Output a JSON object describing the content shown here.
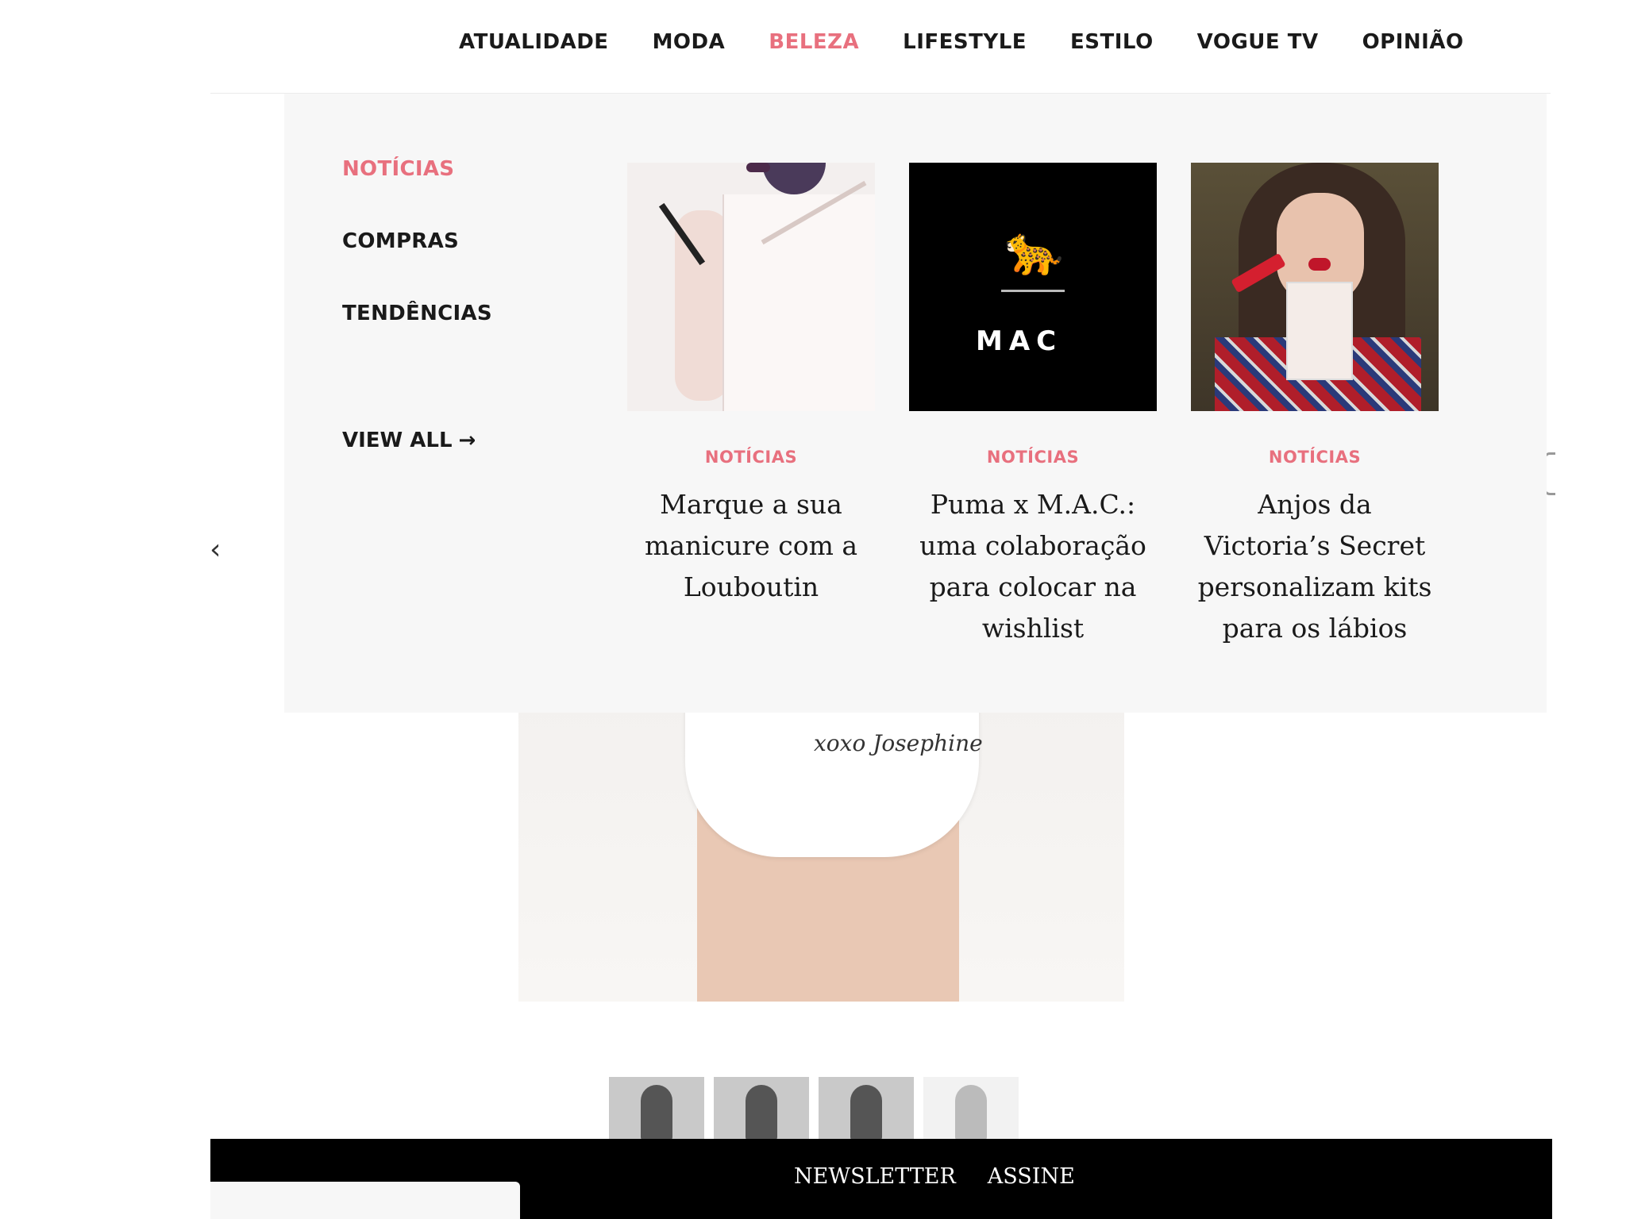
{
  "nav": {
    "items": [
      {
        "label": "ATUALIDADE",
        "active": false
      },
      {
        "label": "MODA",
        "active": false
      },
      {
        "label": "BELEZA",
        "active": true
      },
      {
        "label": "LIFESTYLE",
        "active": false
      },
      {
        "label": "ESTILO",
        "active": false
      },
      {
        "label": "VOGUE TV",
        "active": false
      },
      {
        "label": "OPINIÃO",
        "active": false
      }
    ]
  },
  "mega_menu": {
    "submenu": [
      {
        "label": "NOTÍCIAS",
        "active": true
      },
      {
        "label": "COMPRAS",
        "active": false
      },
      {
        "label": "TENDÊNCIAS",
        "active": false
      }
    ],
    "view_all": "VIEW ALL",
    "view_all_arrow": "→",
    "cards": [
      {
        "tag": "NOTÍCIAS",
        "title": "Marque a sua manicure com a Louboutin"
      },
      {
        "tag": "NOTÍCIAS",
        "title": "Puma x M.A.C.: uma colaboração para colocar na wishlist"
      },
      {
        "tag": "NOTÍCIAS",
        "title": "Anjos da Victoria’s Secret personalizam kits para os lábios"
      }
    ],
    "card2_logo_puma": "🐆",
    "card2_logo_mac": "MAC"
  },
  "hero": {
    "signature": "xoxo Josephine"
  },
  "carousel": {
    "prev_glyph": "‹"
  },
  "footer": {
    "links": [
      "NEWSLETTER",
      "ASSINE"
    ],
    "input_placeholder": ""
  },
  "colors": {
    "accent": "#e8707e",
    "text": "#1a1a1a",
    "menu_bg": "#f7f7f7",
    "footer_bg": "#000000"
  },
  "icons": {
    "view_all_arrow": "arrow-right-icon",
    "carousel_prev": "chevron-left-icon"
  }
}
